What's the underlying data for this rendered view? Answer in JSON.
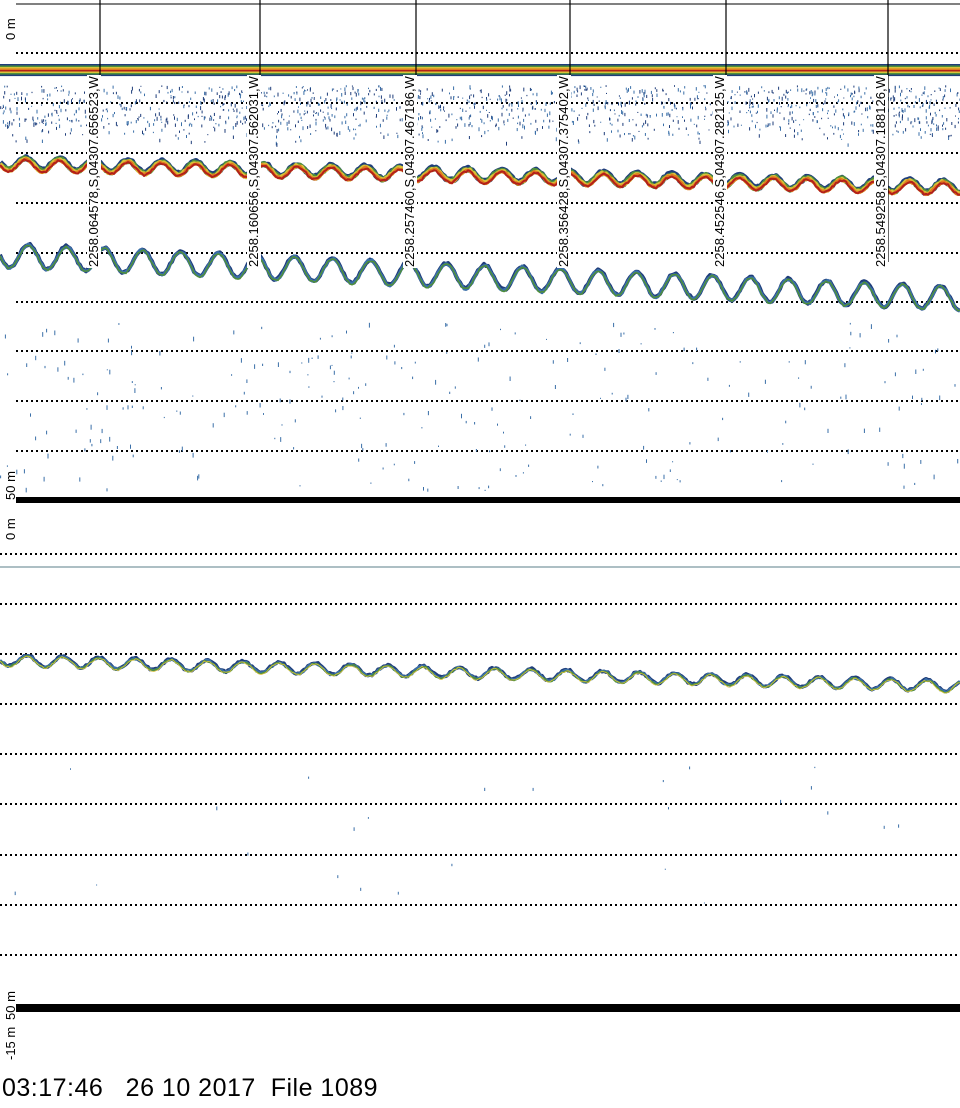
{
  "panels": [
    {
      "name": "upper",
      "depth_top": "0 m",
      "depth_bottom": "50 m"
    },
    {
      "name": "lower",
      "depth_top": "0 m",
      "depth_bottom": "50 m",
      "depth_extra": "-15 m"
    }
  ],
  "position_labels": [
    "2258.064578,S,04307.656523,W",
    "2258.160656,S,04307.562031,W",
    "2258.257460,S,04307.467186,W",
    "2258.356428,S,04307.375402,W",
    "2258.452546,S,04307.282125,W",
    "2258.549258,S,04307.188126,W"
  ],
  "footer": {
    "time": "03:17:46",
    "date": "26 10 2017",
    "file": "File 1089"
  },
  "colors": {
    "echo_dark": "#1f3d7a",
    "echo_mid": "#3a6fa8",
    "echo_green": "#4f8f3a",
    "echo_yellow": "#d8c23a",
    "echo_orange": "#e07a1f",
    "echo_red": "#b3201a",
    "grid": "#000000",
    "separator": "#000000"
  }
}
